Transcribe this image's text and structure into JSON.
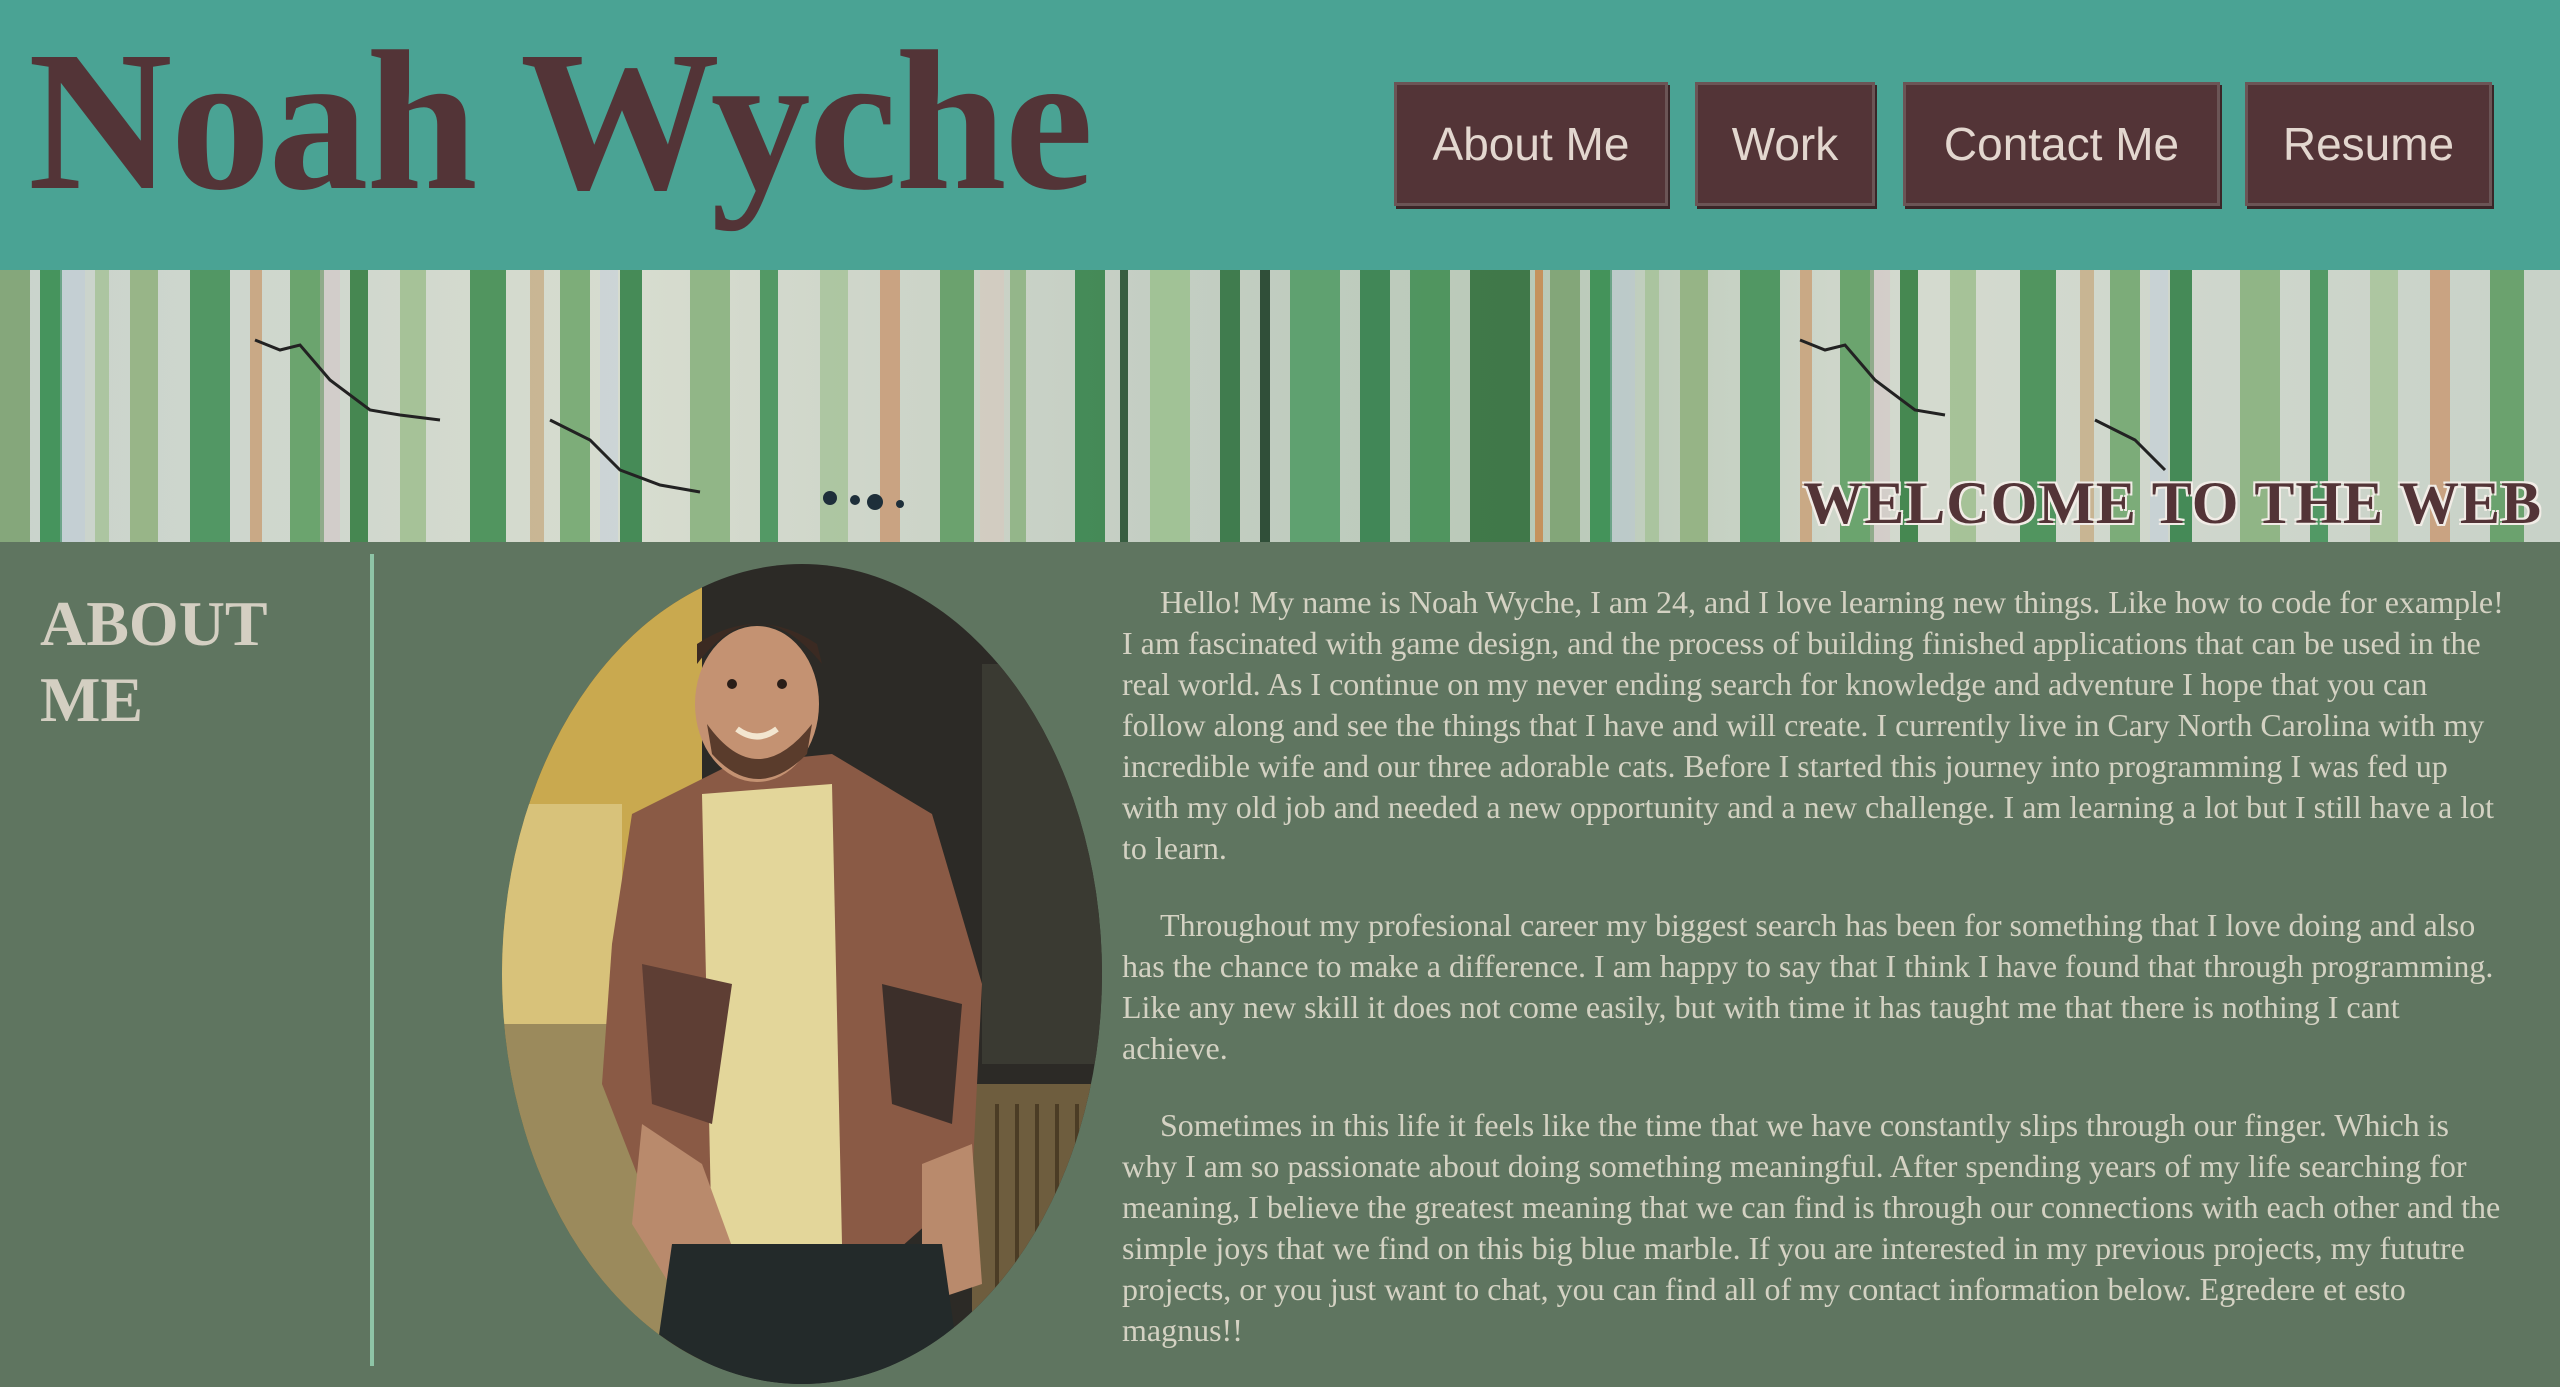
{
  "header": {
    "site_title": "Noah Wyche",
    "nav": [
      {
        "label": "About Me"
      },
      {
        "label": "Work"
      },
      {
        "label": "Contact Me"
      },
      {
        "label": "Resume"
      }
    ]
  },
  "banner": {
    "caption": "WELCOME TO THE WEB"
  },
  "about": {
    "heading": "ABOUT ME",
    "paragraphs": [
      "Hello! My name is Noah Wyche, I am 24, and I love learning new things. Like how to code for example! I am fascinated with game design, and the process of building finished applications that can be used in the real world. As I continue on my never ending search for knowledge and adventure I hope that you can follow along and see the things that I have and will create. I currently live in Cary North Carolina with my incredible wife and our three adorable cats. Before I started this journey into programming I was fed up with my old job and needed a new opportunity and a new challenge. I am learning a lot but I still have a lot to learn.",
      "Throughout my profesional career my biggest search has been for something that I love doing and also has the chance to make a difference. I am happy to say that I think I have found that through programming. Like any new skill it does not come easily, but with time it has taught me that there is nothing I cant achieve.",
      "Sometimes in this life it feels like the time that we have constantly slips through our finger. Which is why I am so passionate about doing something meaningful. After spending years of my life searching for meaning, I believe the greatest meaning that we can find is through our connections with each other and the simple joys that we find on this big blue marble. If you are interested in my previous projects, my fututre projects, or you just want to chat, you can find all of my contact information below. Egredere et esto magnus!!"
    ]
  },
  "colors": {
    "header_bg": "#4aa394",
    "title": "#533437",
    "nav_bg": "#533437",
    "nav_text": "#e3d7cf",
    "section_bg": "#5f7560",
    "body_text": "#d4d2c3",
    "divider": "#8ec4a6"
  }
}
